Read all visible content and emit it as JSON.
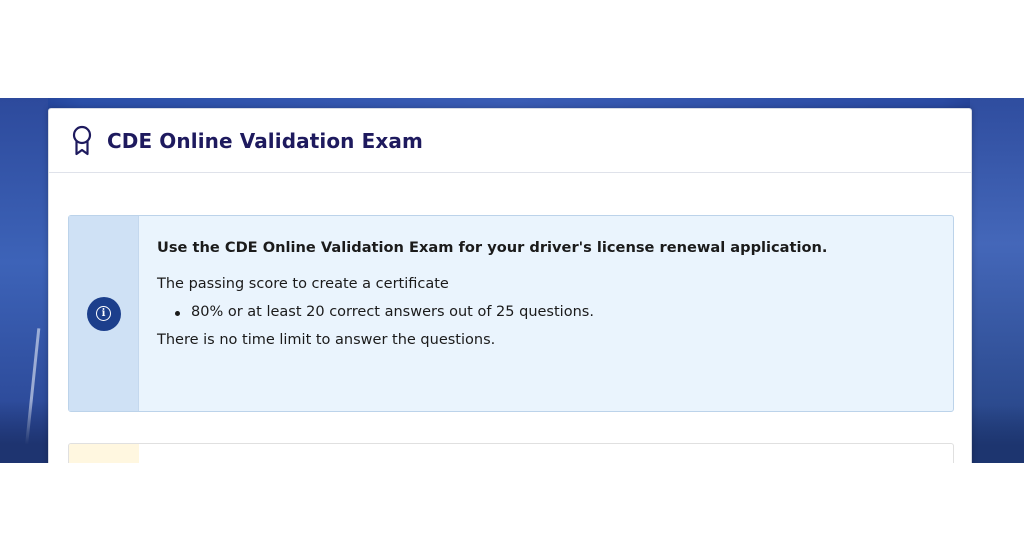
{
  "header": {
    "icon": "award-icon",
    "title": "CDE Online Validation Exam"
  },
  "info_alert": {
    "icon": "info-icon",
    "heading": "Use the CDE Online Validation Exam for your driver's license renewal application.",
    "intro": "The passing score to create a certificate",
    "bullets": [
      "80% or at least 20 correct answers out of 25 questions."
    ],
    "footer": "There is no time limit to answer the questions."
  },
  "colors": {
    "title": "#1e1a5e",
    "info_icon_bg": "#1c3f8c",
    "alert_bg": "#eaf4fd",
    "alert_icon_col": "#cfe1f5",
    "warning_icon_col": "#fff7e0",
    "backdrop": "#2b4fa8"
  }
}
